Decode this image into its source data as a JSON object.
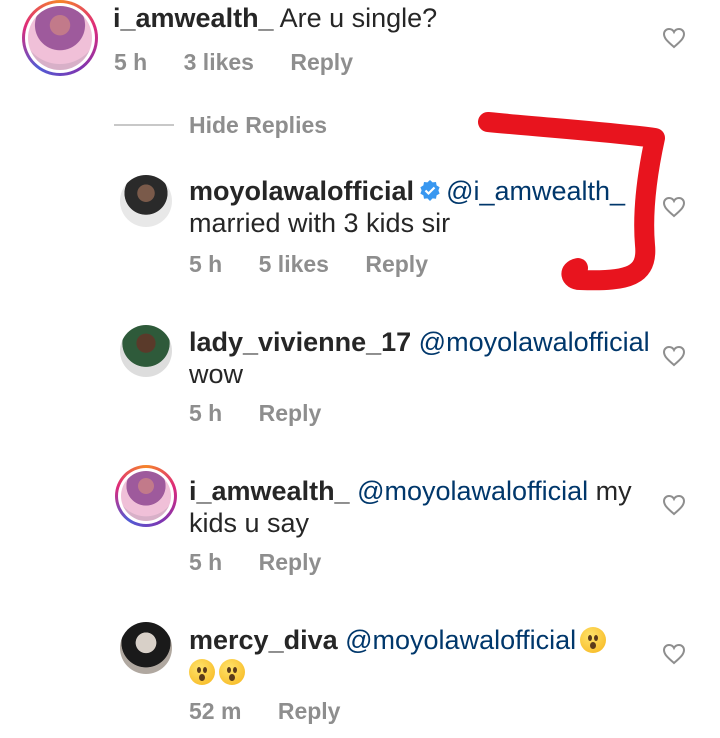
{
  "comments": [
    {
      "username": "i_amwealth_",
      "text": "Are u single?",
      "time": "5 h",
      "likes": "3 likes",
      "reply": "Reply"
    }
  ],
  "thread": {
    "hide_replies": "Hide Replies"
  },
  "replies": [
    {
      "username": "moyolawalofficial",
      "mention": "@i_amwealth_",
      "text": "married with 3 kids sir",
      "time": "5 h",
      "likes": "5 likes",
      "reply": "Reply",
      "verified": true
    },
    {
      "username": "lady_vivienne_17",
      "mention": "@moyolawalofficial",
      "text": "wow",
      "time": "5 h",
      "reply": "Reply"
    },
    {
      "username": "i_amwealth_",
      "mention": "@moyolawalofficial",
      "text_inline": "my",
      "text": "kids u say",
      "time": "5 h",
      "reply": "Reply"
    },
    {
      "username": "mercy_diva",
      "mention": "@moyolawalofficial",
      "time": "52 m",
      "reply": "Reply"
    }
  ],
  "icons": {
    "heart": "heart-outline-icon",
    "verified": "verified-badge-icon",
    "emoji": "hushed-face-emoji"
  },
  "colors": {
    "mention": "#00376b",
    "meta": "#8e8e8e",
    "verified": "#3897f0",
    "annotation": "#e8141e"
  }
}
